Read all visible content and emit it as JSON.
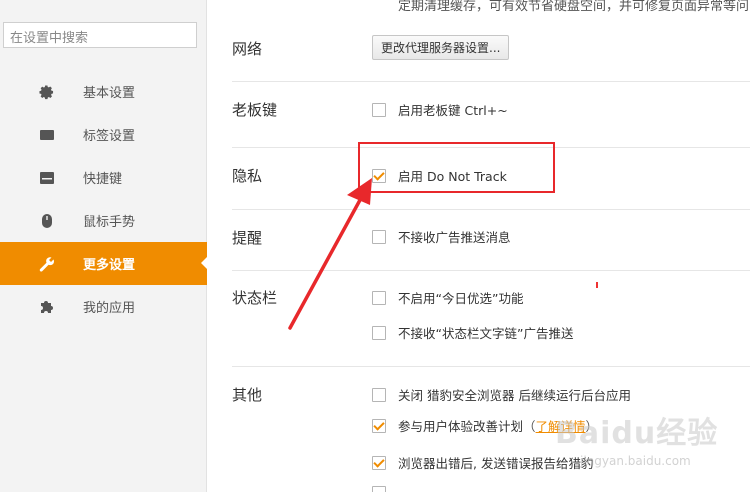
{
  "sidebar": {
    "search_placeholder": "在设置中搜索",
    "items": [
      {
        "label": "基本设置",
        "icon": "gear-icon"
      },
      {
        "label": "标签设置",
        "icon": "tab-icon"
      },
      {
        "label": "快捷键",
        "icon": "keyboard-icon"
      },
      {
        "label": "鼠标手势",
        "icon": "mouse-icon"
      },
      {
        "label": "更多设置",
        "icon": "wrench-icon",
        "active": true
      },
      {
        "label": "我的应用",
        "icon": "puzzle-icon"
      }
    ]
  },
  "main": {
    "top_note": "定期清理缓存，可有效节省硬盘空间，并可修复页面异常等问",
    "network": {
      "title": "网络",
      "button": "更改代理服务器设置..."
    },
    "boss_key": {
      "title": "老板键",
      "option": "启用老板键  Ctrl+~",
      "checked": false
    },
    "privacy": {
      "title": "隐私",
      "option": "启用 Do Not Track",
      "checked": true
    },
    "reminder": {
      "title": "提醒",
      "option": "不接收广告推送消息",
      "checked": false
    },
    "statusbar": {
      "title": "状态栏",
      "options": [
        {
          "label": "不启用“今日优选”功能",
          "checked": false
        },
        {
          "label": "不接收“状态栏文字链”广告推送",
          "checked": false
        }
      ]
    },
    "other": {
      "title": "其他",
      "options": [
        {
          "label": "关闭 猎豹安全浏览器 后继续运行后台应用",
          "checked": false
        },
        {
          "label": "参与用户体验改善计划",
          "paren_open": "（",
          "link": "了解详情",
          "paren_close": "）",
          "checked": true
        },
        {
          "label": "浏览器出错后, 发送错误报告给猎豹",
          "checked": true
        }
      ]
    }
  },
  "watermark": {
    "text": "Baidu经验",
    "url": "jingyan.baidu.com"
  },
  "colors": {
    "accent": "#f08c00",
    "annotation": "#e8282b"
  }
}
